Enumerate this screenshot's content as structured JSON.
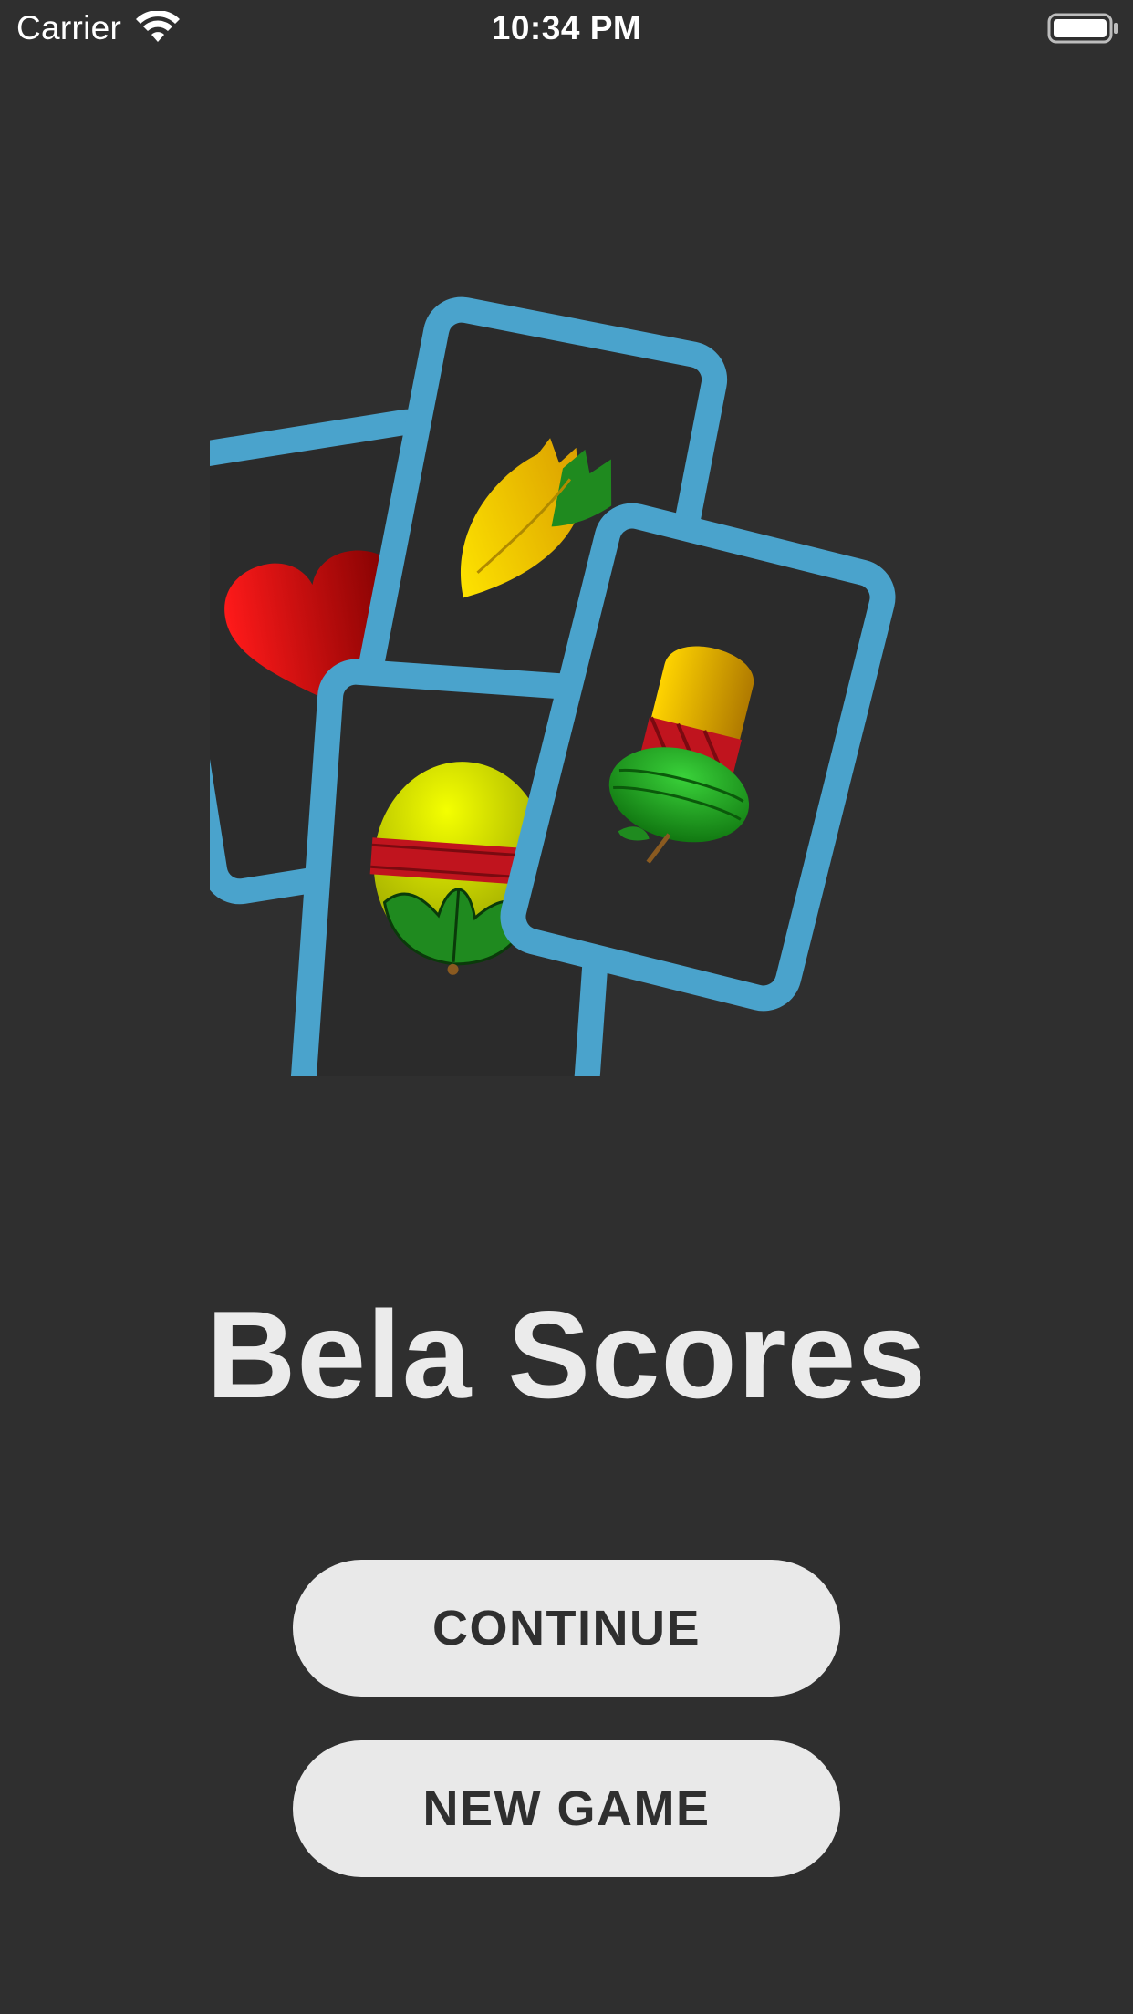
{
  "status_bar": {
    "carrier": "Carrier",
    "time": "10:34 PM",
    "wifi_icon": "wifi-icon",
    "battery_icon": "battery-icon"
  },
  "logo": {
    "icon": "playing-cards-logo",
    "suits": [
      "heart-suit",
      "leaf-suit",
      "acorn-suit",
      "bell-suit"
    ],
    "colors": {
      "card_border": "#4aa3cc",
      "card_face": "#2b2b2b",
      "heart": "#e00000",
      "leaf_yellow": "#f2c200",
      "leaf_green": "#1f8a1f",
      "acorn_yellow": "#d8e000",
      "bell_yellow": "#f0c000",
      "bell_green": "#1ea01e",
      "band_red": "#c0141e"
    }
  },
  "app": {
    "title": "Bela Scores"
  },
  "actions": {
    "continue_label": "CONTINUE",
    "new_game_label": "NEW GAME"
  },
  "colors": {
    "background": "#2f2f2f",
    "title_text": "#ebebeb",
    "button_bg": "#e9e9e9",
    "button_text": "#2f2f2f"
  }
}
